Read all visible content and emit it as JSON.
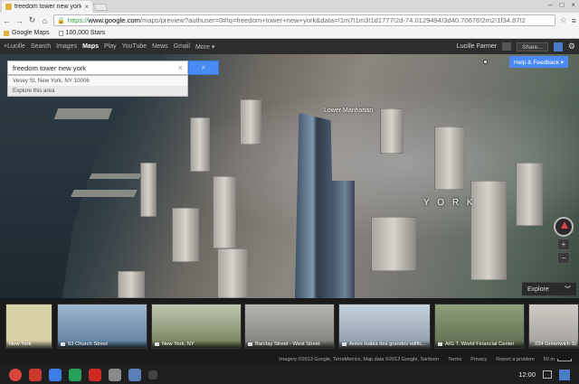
{
  "browser": {
    "tab_title": "freedom tower new york",
    "tab_close": "×",
    "window_controls": [
      "–",
      "□",
      "×"
    ],
    "url_scheme": "https://",
    "url_host": "www.google.com",
    "url_rest": "/maps/preview?authuser=0#!q=freedom+tower+new+york&data=!1m7!1m3!1d1777!2d-74.0129494!3d40.70676!2m2!1f34.87!2",
    "bookmarks": [
      "Google Maps",
      "100,000 Stars"
    ]
  },
  "gbar": {
    "links": [
      "+Lucille",
      "Search",
      "Images",
      "Maps",
      "Play",
      "YouTube",
      "News",
      "Gmail",
      "More ▾"
    ],
    "active": "Maps",
    "user_name": "Lucille Farmer",
    "share_label": "Share..."
  },
  "search": {
    "query": "freedom tower new york",
    "clear_symbol": "×",
    "button_icon": "magnifier-icon",
    "suggestions": [
      "Vesey St, New York, NY 10006",
      "Explore this area"
    ]
  },
  "map": {
    "help_feedback": "Help & Feedback ▾",
    "labels": {
      "lower_manhattan": "Lower Manhattan",
      "york": "Y O R K"
    },
    "controls": {
      "zoom_in": "+",
      "zoom_out": "−"
    },
    "explore_label": "Explore",
    "explore_chevron": "︾"
  },
  "photos": [
    {
      "caption": "New York",
      "bg": "#d9d2a8",
      "camera": false
    },
    {
      "caption": "53 Church Street",
      "bg": "#5a7ea0",
      "camera": true
    },
    {
      "caption": "New York, NY",
      "bg": "#6f7d54",
      "camera": true
    },
    {
      "caption": "Barclay Street - West Street",
      "bg": "#7d7c78",
      "camera": true
    },
    {
      "caption": "Antes Habia dos grandes edific...",
      "bg": "#8d9aa8",
      "camera": true
    },
    {
      "caption": "AIG T. World Financial Center",
      "bg": "#5d6b4d",
      "camera": true
    },
    {
      "caption": "234 Greenwich St",
      "bg": "#a09e98",
      "camera": true
    }
  ],
  "footer": {
    "imagery": "Imagery ©2013 Google, TerraMetrics, Map data ©2013 Google, Sanborn",
    "links": [
      "Terms",
      "Privacy",
      "Report a problem"
    ],
    "scale": "50 m"
  },
  "shelf": {
    "apps": [
      {
        "name": "chrome",
        "color": "#d9463e"
      },
      {
        "name": "gmail",
        "color": "#c73a2d"
      },
      {
        "name": "google-search",
        "color": "#3d7ee6"
      },
      {
        "name": "drive",
        "color": "#27a05a"
      },
      {
        "name": "youtube",
        "color": "#cc2a23"
      },
      {
        "name": "maps-window",
        "color": "#8a8a8a"
      },
      {
        "name": "files",
        "color": "#5d7fb8"
      }
    ],
    "clock": "12:00"
  }
}
